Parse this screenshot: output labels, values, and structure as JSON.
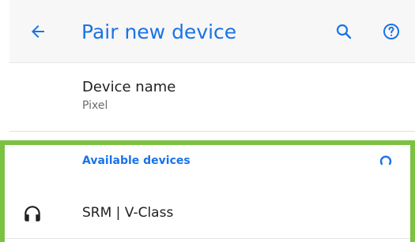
{
  "app_bar": {
    "title": "Pair new device",
    "back_icon": "arrow-left-icon",
    "search_icon": "search-icon",
    "help_icon": "help-circle-icon",
    "title_color": "#1a73e8"
  },
  "device_name": {
    "label": "Device name",
    "value": "Pixel"
  },
  "available_devices": {
    "header": "Available devices",
    "spinner_icon": "refresh-spinner-icon",
    "highlight_color": "#7cc242",
    "devices": [
      {
        "name": "SRM | V-Class",
        "icon": "headphones-icon"
      }
    ]
  }
}
